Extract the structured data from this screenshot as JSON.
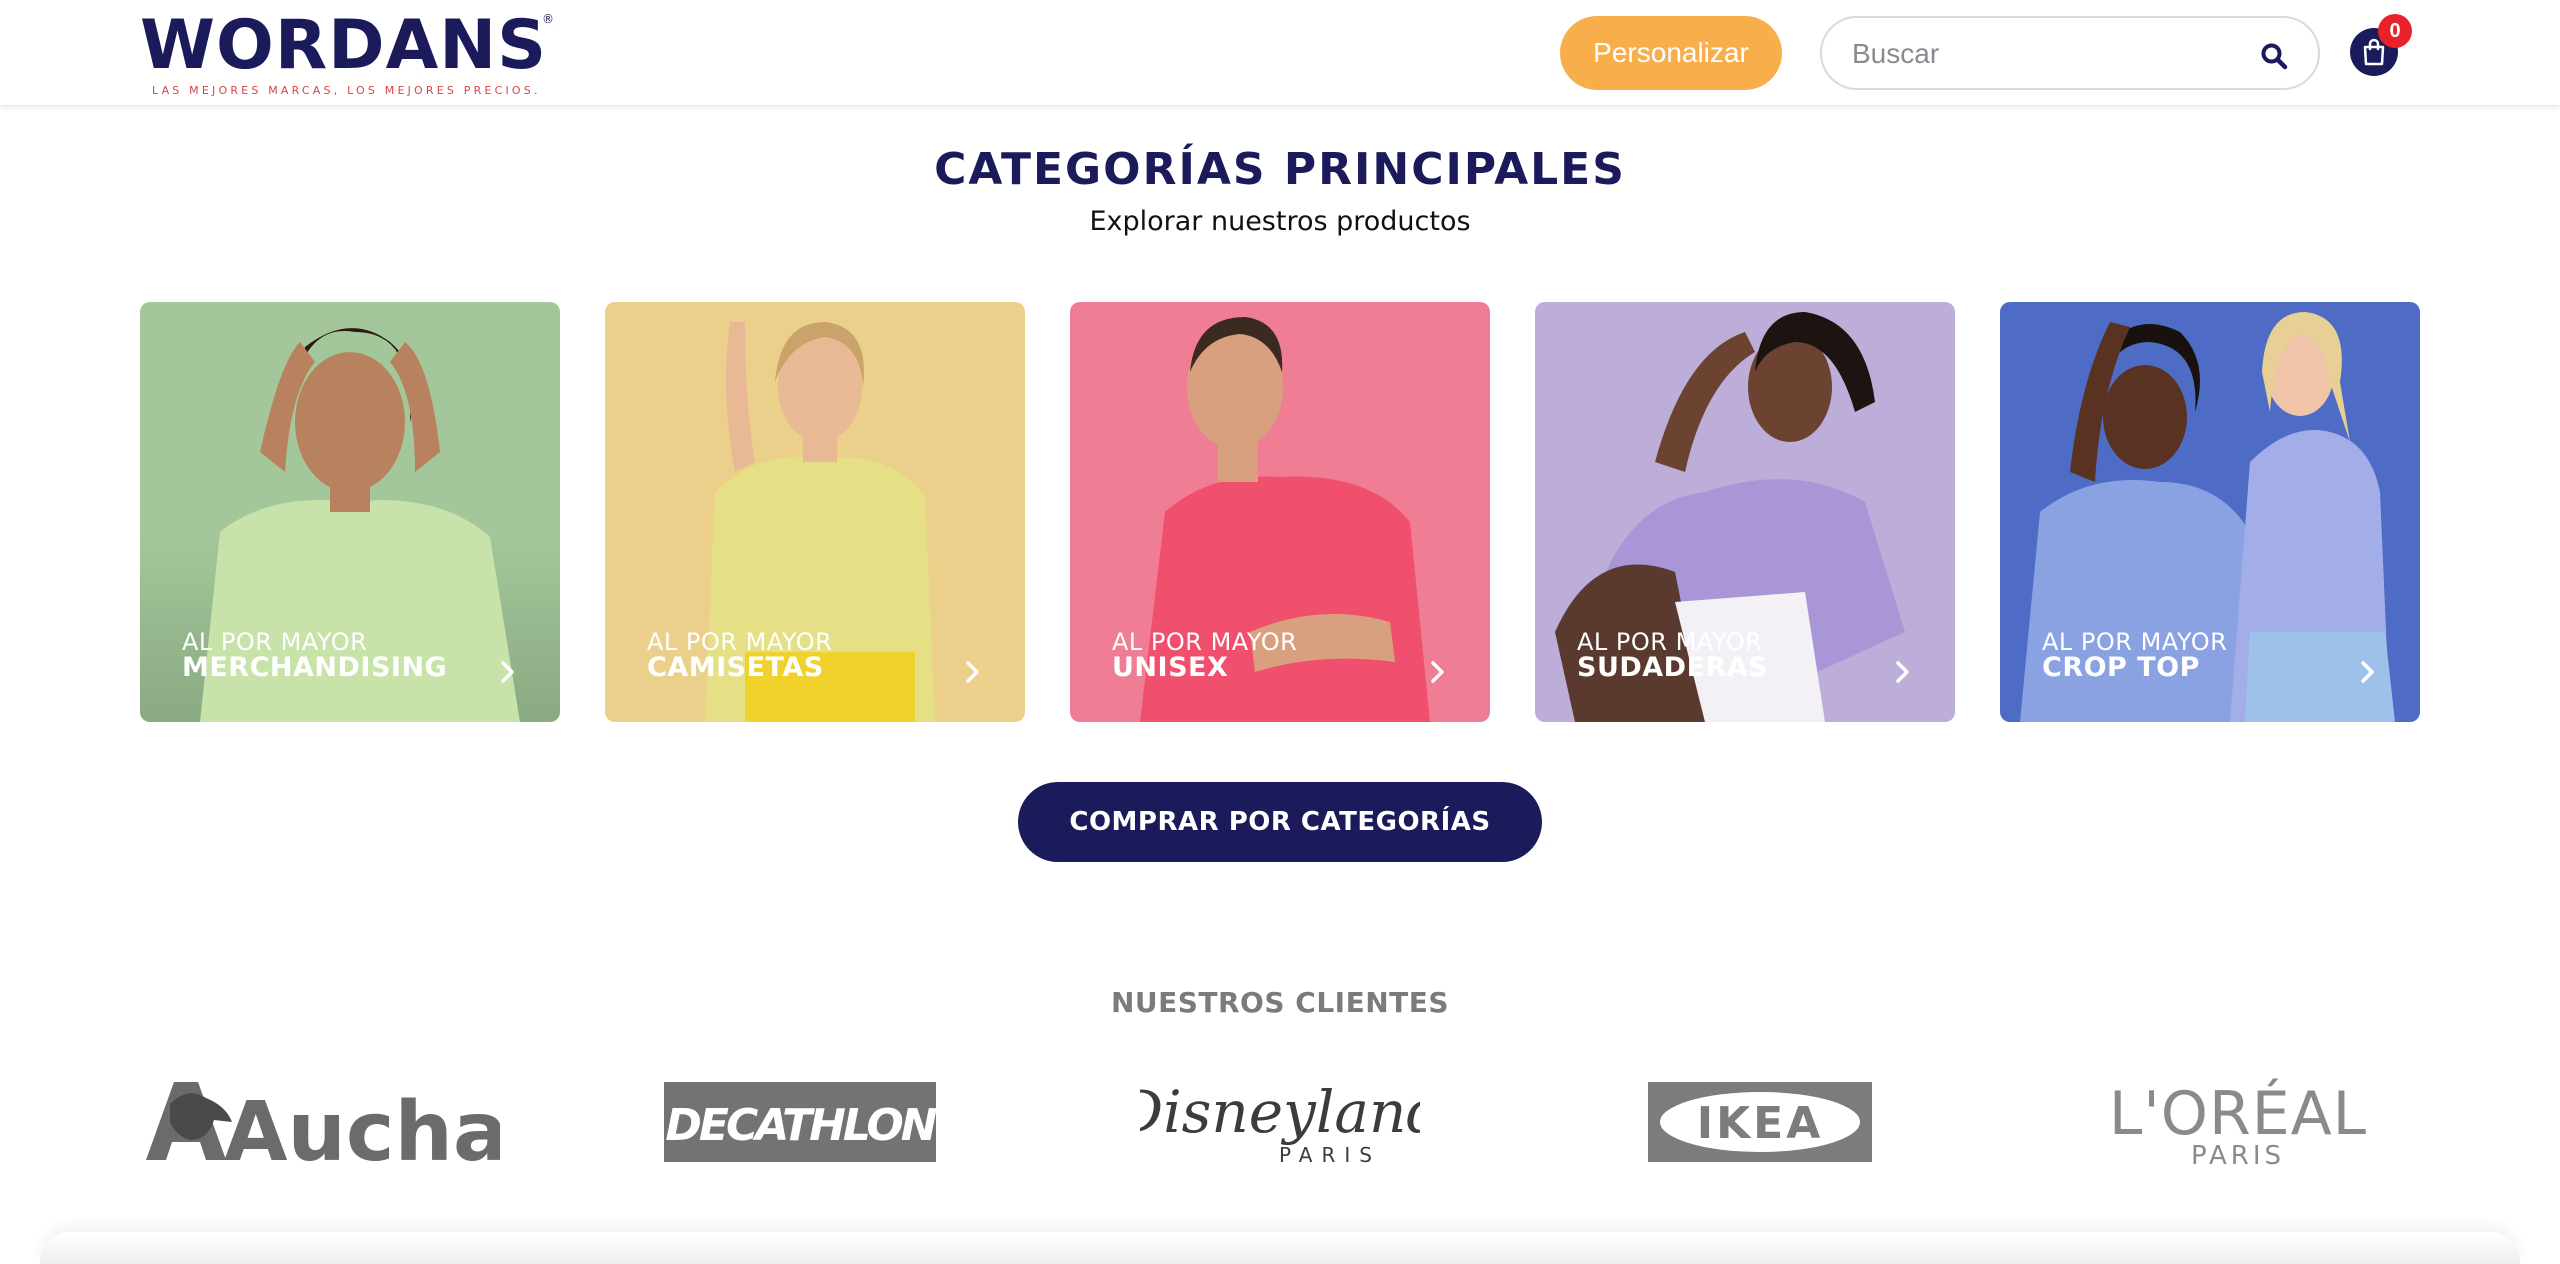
{
  "header": {
    "logo_text": "WORDANS",
    "logo_reg": "®",
    "logo_tagline": "LAS MEJORES MARCAS, LOS MEJORES PRECIOS.",
    "personalize_label": "Personalizar",
    "search_placeholder": "Buscar",
    "cart_count": "0"
  },
  "categories": {
    "title": "CATEGORÍAS PRINCIPALES",
    "subtitle": "Explorar nuestros productos",
    "items": [
      {
        "prefix": "AL POR MAYOR",
        "name": "MERCHANDISING",
        "bg": "#a3c79a"
      },
      {
        "prefix": "AL POR MAYOR",
        "name": "CAMISETAS",
        "bg": "#ead08a"
      },
      {
        "prefix": "AL POR MAYOR",
        "name": "UNISEX",
        "bg": "#ef7d93"
      },
      {
        "prefix": "AL POR MAYOR",
        "name": "SUDADERAS",
        "bg": "#bcaed8"
      },
      {
        "prefix": "AL POR MAYOR",
        "name": "CROP TOP",
        "bg": "#4e6cc6"
      }
    ],
    "button_label": "COMPRAR POR CATEGORÍAS"
  },
  "clients": {
    "title": "NUESTROS CLIENTES",
    "logos": [
      "Auchan",
      "DECATHLON",
      "Disneyland",
      "PARIS",
      "IKEA",
      "L'ORÉAL",
      "PARIS"
    ]
  },
  "colors": {
    "navy": "#1b1a5a",
    "orange": "#f8af4b",
    "badge_red": "#e8212b",
    "client_grey": "#7b7b7b"
  }
}
